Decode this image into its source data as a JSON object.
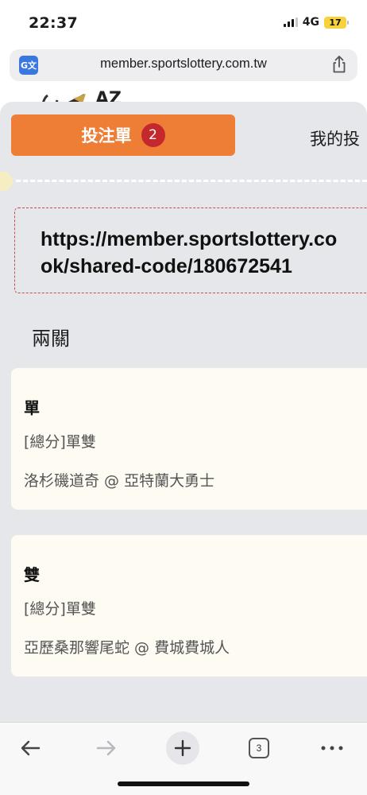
{
  "status_bar": {
    "time": "22:37",
    "network": "4G",
    "battery": "17"
  },
  "browser": {
    "url": "member.sportslottery.com.tw",
    "open_tabs": "3"
  },
  "page_peek": {
    "text": "AZ"
  },
  "sheet": {
    "tab_betslip": {
      "label": "投注單",
      "badge": "2"
    },
    "tab_mybets": {
      "label": "我的投"
    },
    "share_link": {
      "line1": "https://member.sportslottery.co",
      "line2": "ok/shared-code/180672541"
    },
    "combo_label": "兩關",
    "bets": [
      {
        "selection": "單",
        "market": "[總分]單雙",
        "match": "洛杉磯道奇 @ 亞特蘭大勇士"
      },
      {
        "selection": "雙",
        "market": "[總分]單雙",
        "match": "亞歷桑那響尾蛇 @ 費城費城人"
      }
    ]
  },
  "colors": {
    "accent": "#ee7d35",
    "badge": "#c4282c",
    "sheet_bg": "#e6e7ea",
    "card_bg": "#fdfbf2",
    "dashed_border": "#c94c47"
  }
}
